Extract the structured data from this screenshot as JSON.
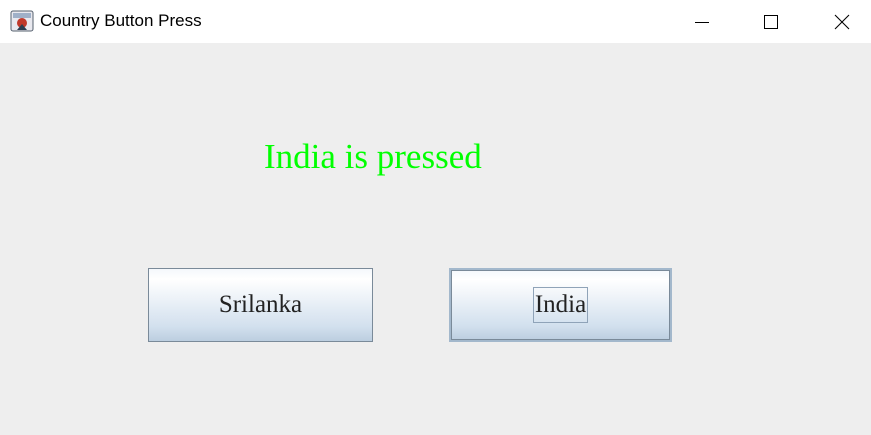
{
  "window": {
    "title": "Country Button Press",
    "controls": {
      "minimize": "minimize-icon",
      "maximize": "maximize-icon",
      "close": "close-icon"
    },
    "app_icon": "java-icon"
  },
  "status": {
    "text": "India is pressed",
    "color": "#00ff00"
  },
  "buttons": {
    "srilanka_label": "Srilanka",
    "india_label": "India",
    "focused": "India"
  },
  "colors": {
    "background": "#eeeeee",
    "titlebar": "#ffffff"
  }
}
